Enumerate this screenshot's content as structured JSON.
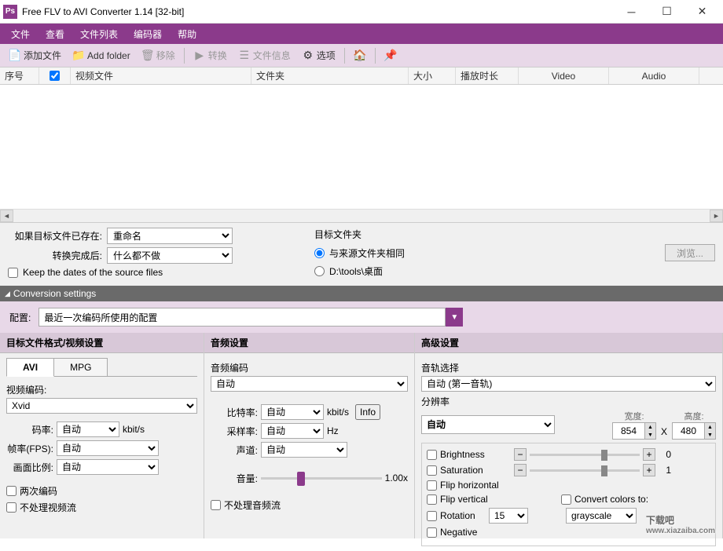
{
  "titlebar": {
    "app_icon": "Ps",
    "title": "Free FLV to AVI Converter 1.14  [32-bit]"
  },
  "menubar": {
    "items": [
      "文件",
      "查看",
      "文件列表",
      "编码器",
      "帮助"
    ]
  },
  "toolbar": {
    "add_file": "添加文件",
    "add_folder": "Add folder",
    "remove": "移除",
    "convert": "转换",
    "file_info": "文件信息",
    "options": "选项"
  },
  "table": {
    "headers": {
      "seq": "序号",
      "video_file": "视频文件",
      "folder": "文件夹",
      "size": "大小",
      "duration": "播放时长",
      "video": "Video",
      "audio": "Audio"
    }
  },
  "options": {
    "if_exists_label": "如果目标文件已存在:",
    "if_exists_value": "重命名",
    "after_conv_label": "转换完成后:",
    "after_conv_value": "什么都不做",
    "keep_dates_label": "Keep the dates of the source files",
    "target_folder_label": "目标文件夹",
    "same_as_source": "与来源文件夹相同",
    "custom_path": "D:\\tools\\桌面",
    "browse": "浏览..."
  },
  "conv_settings_title": "Conversion settings",
  "config": {
    "label": "配置:",
    "value": "最近一次编码所使用的配置"
  },
  "video_panel": {
    "header": "目标文件格式/视频设置",
    "tabs": [
      "AVI",
      "MPG"
    ],
    "codec_label": "视频编码:",
    "codec_value": "Xvid",
    "bitrate_label": "码率:",
    "bitrate_value": "自动",
    "bitrate_unit": "kbit/s",
    "fps_label": "帧率(FPS):",
    "fps_value": "自动",
    "aspect_label": "画面比例:",
    "aspect_value": "自动",
    "two_pass": "两次编码",
    "skip_video": "不处理视频流"
  },
  "audio_panel": {
    "header": "音频设置",
    "codec_label": "音频编码",
    "codec_value": "自动",
    "bitrate_label": "比特率:",
    "bitrate_value": "自动",
    "bitrate_unit": "kbit/s",
    "samplerate_label": "采样率:",
    "samplerate_value": "自动",
    "samplerate_unit": "Hz",
    "channels_label": "声道:",
    "channels_value": "自动",
    "volume_label": "音量:",
    "volume_value": "1.00x",
    "info_btn": "Info",
    "skip_audio": "不处理音频流"
  },
  "advanced_panel": {
    "header": "高级设置",
    "track_label": "音轨选择",
    "track_value": "自动 (第一音轨)",
    "resolution_label": "分辨率",
    "resolution_value": "自动",
    "width_label": "宽度:",
    "width_value": "854",
    "x": "X",
    "height_label": "高度:",
    "height_value": "480",
    "brightness": "Brightness",
    "brightness_val": "0",
    "saturation": "Saturation",
    "saturation_val": "1",
    "flip_h": "Flip horizontal",
    "flip_v": "Flip vertical",
    "convert_colors": "Convert colors to:",
    "grayscale": "grayscale",
    "rotation": "Rotation",
    "rotation_value": "15",
    "negative": "Negative"
  },
  "watermark": {
    "main": "下载吧",
    "sub": "www.xiazaiba.com"
  }
}
